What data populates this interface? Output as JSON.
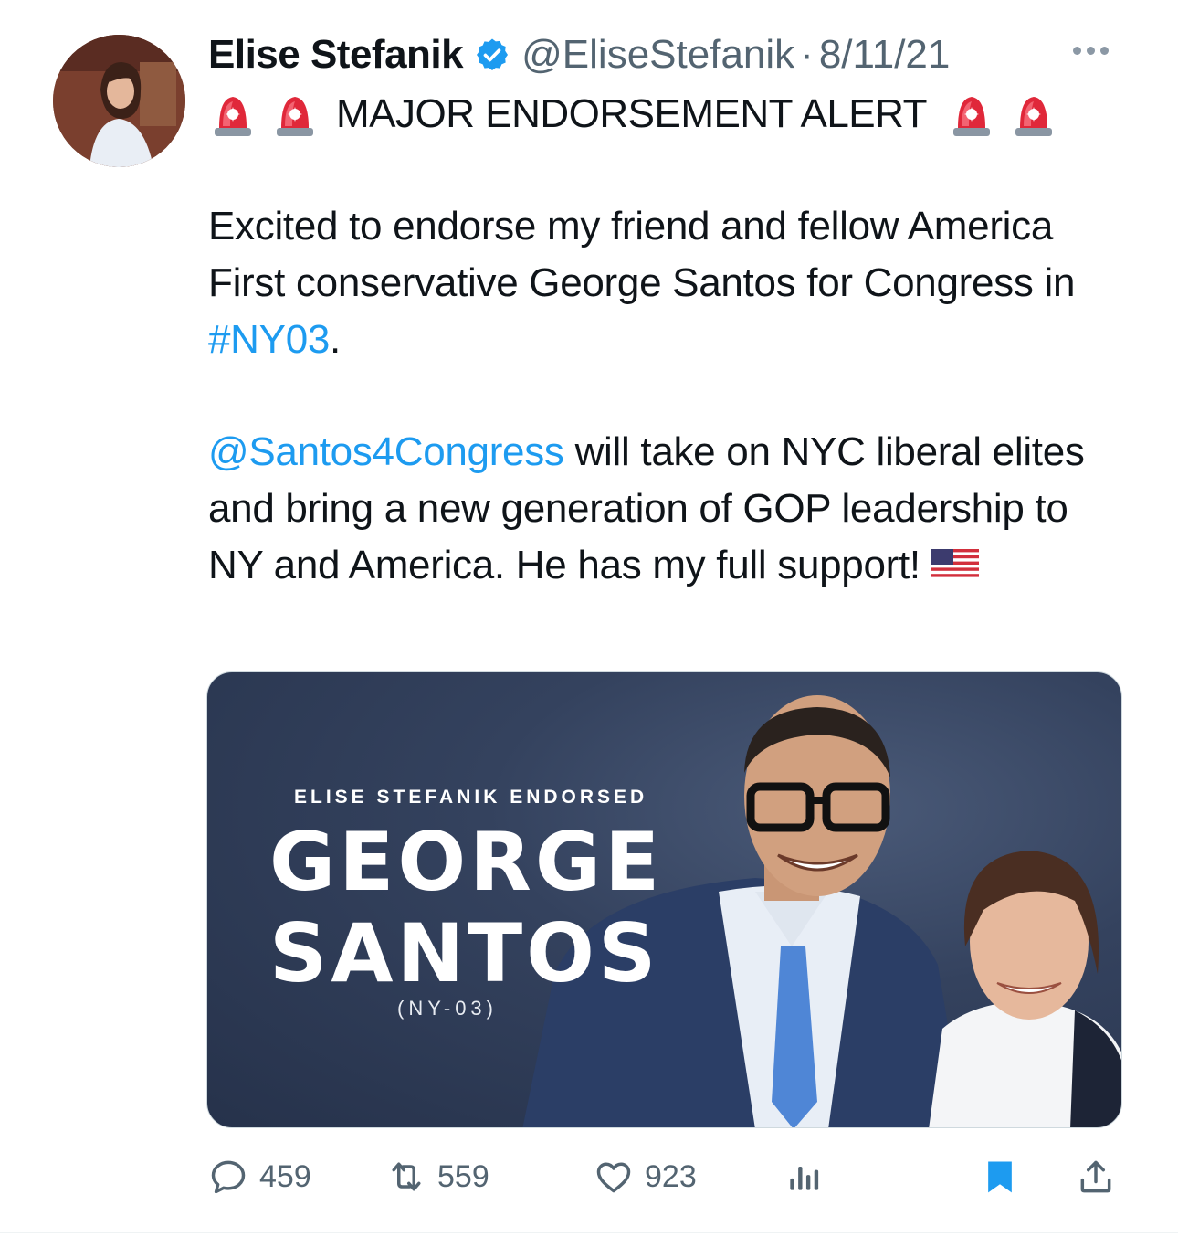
{
  "author": {
    "name": "Elise Stefanik",
    "handle": "@EliseStefanik",
    "separator": "·",
    "date": "8/11/21"
  },
  "tweet": {
    "alert_text": "MAJOR ENDORSEMENT ALERT",
    "p1_text": "Excited to endorse my friend and fellow America First conservative George Santos for Congress in ",
    "p1_hashtag": "#NY03",
    "p1_end": ".",
    "p2_mention": "@Santos4Congress",
    "p2_text": " will take on NYC liberal elites and bring a new generation of GOP leadership to NY and America. He has my full support!"
  },
  "card": {
    "kicker": "ELISE STEFANIK ENDORSED",
    "title_line1": "GEORGE",
    "title_line2": "SANTOS",
    "district": "(NY-03)"
  },
  "actions": {
    "replies": "459",
    "retweets": "559",
    "likes": "923"
  },
  "colors": {
    "link": "#1d9bf0",
    "bookmark_active": "#1d9bf0",
    "muted": "#536471",
    "card_bg": "#2c3a55"
  },
  "icons": [
    "verified-badge-icon",
    "more-icon",
    "siren-icon",
    "us-flag-icon",
    "reply-icon",
    "retweet-icon",
    "like-icon",
    "views-icon",
    "bookmark-icon",
    "share-icon"
  ]
}
